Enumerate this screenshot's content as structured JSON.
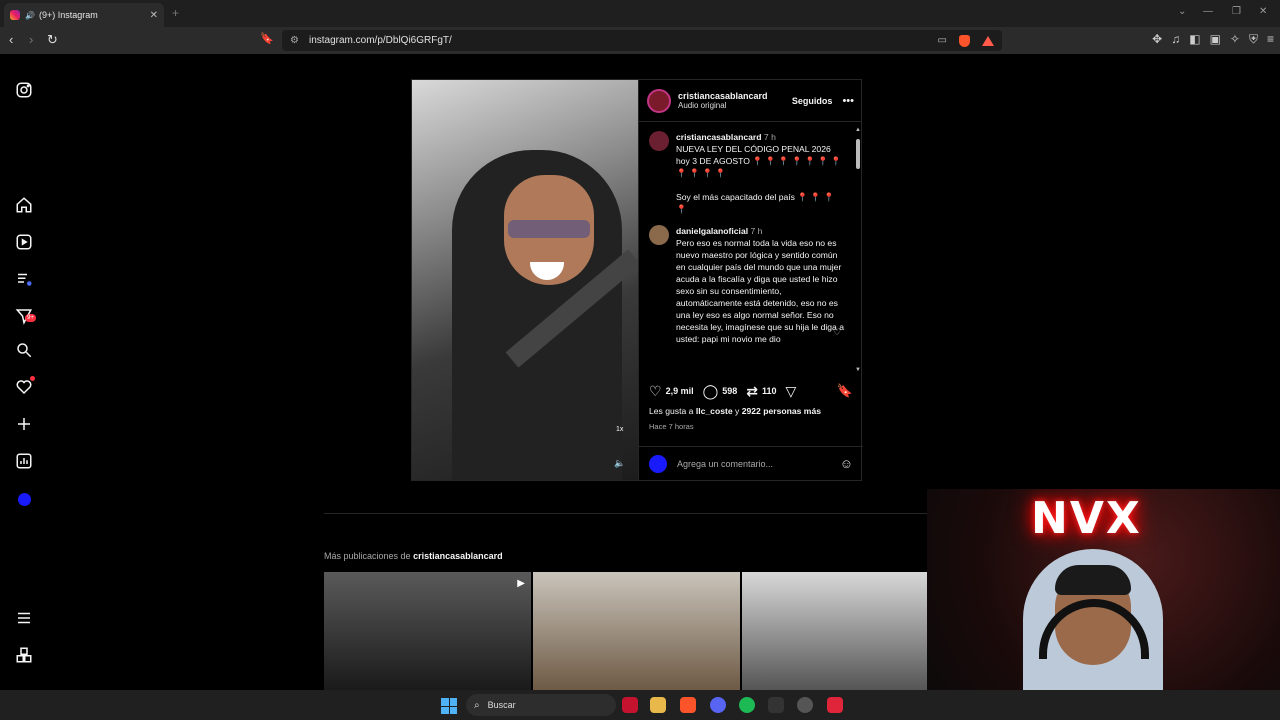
{
  "browser": {
    "tab_title": "(9+) Instagram",
    "new_tab": "+",
    "url": "instagram.com/p/DblQi6GRFgT/"
  },
  "post": {
    "author": "cristiancasablancard",
    "audio": "Audio original",
    "follow_label": "Seguidos",
    "comments": [
      {
        "user": "cristiancasablancard",
        "time": "7 h",
        "text": "NUEVA LEY DEL CÓDIGO PENAL 2026 hoy 3 DE AGOSTO 📍 📍 📍 📍 📍 📍 📍 📍 📍 📍 📍",
        "text2": "Soy el más capacitado del país 📍 📍 📍 📍"
      },
      {
        "user": "danielgalanoficial",
        "time": "7 h",
        "text": "Pero eso es normal toda la vida eso no es nuevo maestro por lógica y sentido común en cualquier país del mundo que una mujer acuda a la fiscalía y diga que usted le hizo sexo sin su consentimiento, automáticamente está detenido, eso no es una ley eso es algo normal señor. Eso no necesita ley, imagínese que su hija le diga a usted: papi mi novio me dio"
      }
    ],
    "likes_count": "2,9 mil",
    "comments_count": "598",
    "reposts_count": "110",
    "liked_by_prefix": "Les gusta a",
    "liked_by_user": "llc_coste",
    "liked_by_join": "y",
    "liked_by_rest": "2922 personas más",
    "time_ago": "Hace 7 horas",
    "comment_placeholder": "Agrega un comentario...",
    "speed_label": "1x"
  },
  "more_posts": {
    "prefix": "Más publicaciones de",
    "user": "cristiancasablancard"
  },
  "nav_badge": "9+",
  "cam": {
    "neon_text": "NVX"
  },
  "taskbar": {
    "search_label": "Buscar"
  }
}
